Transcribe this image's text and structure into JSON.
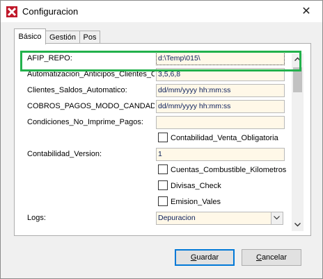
{
  "window": {
    "title": "Configuracion",
    "close_glyph": "✕"
  },
  "tabs": [
    {
      "label": "Básico",
      "active": true
    },
    {
      "label": "Gestión",
      "active": false
    },
    {
      "label": "Pos",
      "active": false
    }
  ],
  "rows": [
    {
      "type": "text",
      "label": "AFIP_REPO:",
      "value": "d:\\Temp\\015\\",
      "focused": true
    },
    {
      "type": "text",
      "label": "Automatizacion_Anticipos_Clientes_C",
      "value": "3,5,6,8"
    },
    {
      "type": "text",
      "label": "Clientes_Saldos_Automatico:",
      "value": "dd/mm/yyyy hh:mm:ss"
    },
    {
      "type": "text",
      "label": "COBROS_PAGOS_MODO_CANDADO",
      "value": "dd/mm/yyyy hh:mm:ss"
    },
    {
      "type": "text",
      "label": "Condiciones_No_Imprime_Pagos:",
      "value": ""
    },
    {
      "type": "check",
      "label": "Contabilidad_Venta_Obligatoria",
      "checked": false
    },
    {
      "type": "text",
      "label": "Contabilidad_Version:",
      "value": "1"
    },
    {
      "type": "check",
      "label": "Cuentas_Combustible_Kilometros",
      "checked": false
    },
    {
      "type": "check",
      "label": "Divisas_Check",
      "checked": false
    },
    {
      "type": "check",
      "label": "Emision_Vales",
      "checked": false
    },
    {
      "type": "combo",
      "label": "Logs:",
      "value": "Depuracion"
    }
  ],
  "buttons": {
    "save_first": "G",
    "save_rest": "uardar",
    "cancel_first": "C",
    "cancel_rest": "ancelar"
  },
  "colors": {
    "highlight": "#22b14c",
    "field_bg": "#fff8e8",
    "default_border": "#0078d7"
  },
  "icons": {
    "app": "red-x-app-icon",
    "close": "close-icon"
  }
}
